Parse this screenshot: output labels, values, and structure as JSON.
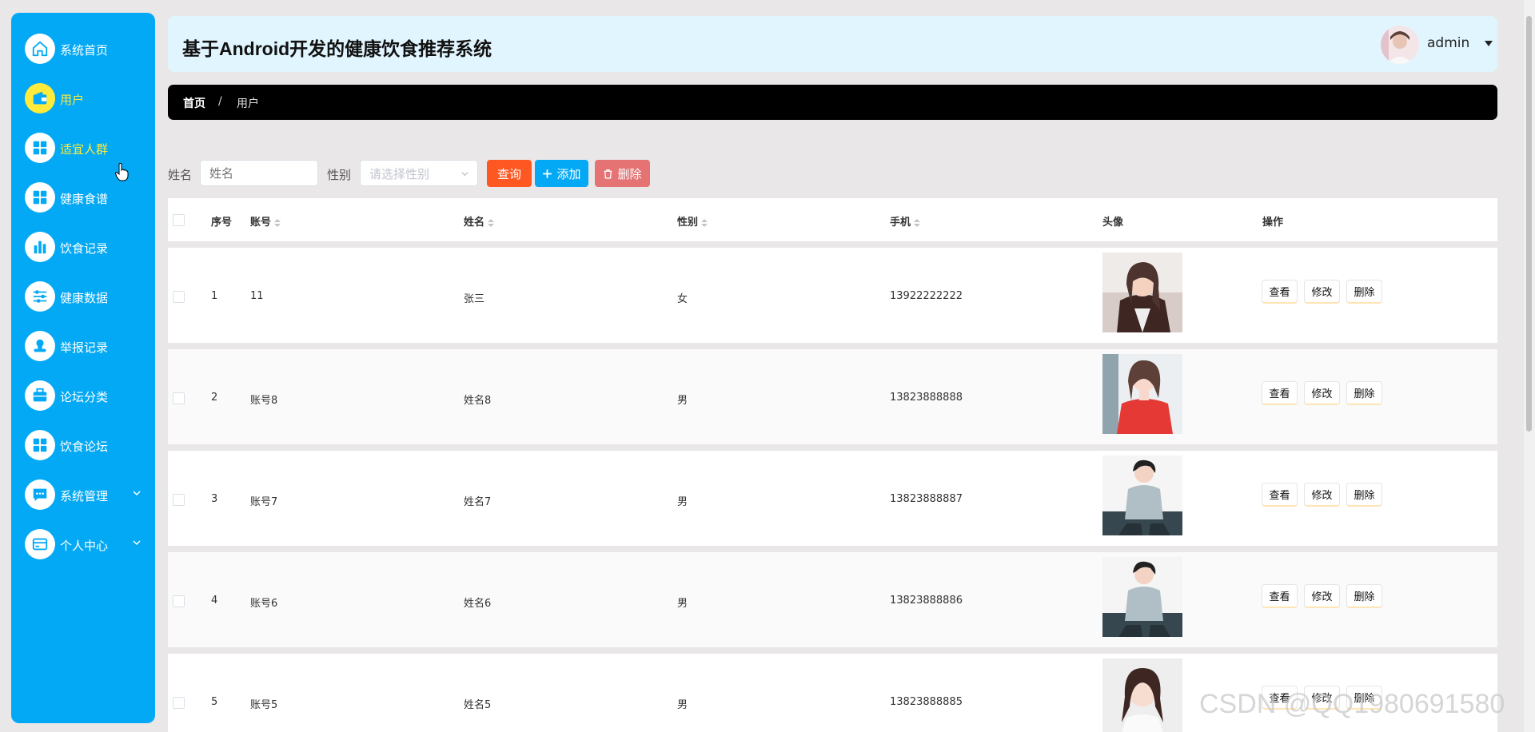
{
  "app": {
    "title": "基于Android开发的健康饮食推荐系统"
  },
  "user": {
    "name": "admin"
  },
  "sidebar": {
    "items": [
      {
        "label": "系统首页",
        "icon": "home-icon"
      },
      {
        "label": "用户",
        "icon": "wallet-icon"
      },
      {
        "label": "适宜人群",
        "icon": "grid-icon"
      },
      {
        "label": "健康食谱",
        "icon": "grid-icon"
      },
      {
        "label": "饮食记录",
        "icon": "bar-chart-icon"
      },
      {
        "label": "健康数据",
        "icon": "sliders-icon"
      },
      {
        "label": "举报记录",
        "icon": "stamp-icon"
      },
      {
        "label": "论坛分类",
        "icon": "briefcase-icon"
      },
      {
        "label": "饮食论坛",
        "icon": "grid-icon"
      },
      {
        "label": "系统管理",
        "icon": "chat-icon"
      },
      {
        "label": "个人中心",
        "icon": "card-icon"
      }
    ]
  },
  "breadcrumb": {
    "home": "首页",
    "separator": "/",
    "current": "用户"
  },
  "search": {
    "name_label": "姓名",
    "name_placeholder": "姓名",
    "gender_label": "性别",
    "gender_placeholder": "请选择性别",
    "query_button": "查询",
    "add_button": "添加",
    "delete_button": "删除"
  },
  "table": {
    "headers": {
      "index": "序号",
      "account": "账号",
      "name": "姓名",
      "gender": "性别",
      "phone": "手机",
      "avatar": "头像",
      "actions": "操作"
    },
    "action_labels": {
      "view": "查看",
      "edit": "修改",
      "delete": "删除"
    },
    "rows": [
      {
        "index": "1",
        "account": "11",
        "name": "张三",
        "gender": "女",
        "phone": "13922222222"
      },
      {
        "index": "2",
        "account": "账号8",
        "name": "姓名8",
        "gender": "男",
        "phone": "13823888888"
      },
      {
        "index": "3",
        "account": "账号7",
        "name": "姓名7",
        "gender": "男",
        "phone": "13823888887"
      },
      {
        "index": "4",
        "account": "账号6",
        "name": "姓名6",
        "gender": "男",
        "phone": "13823888886"
      },
      {
        "index": "5",
        "account": "账号5",
        "name": "姓名5",
        "gender": "男",
        "phone": "13823888885"
      }
    ]
  },
  "watermark": "CSDN @QQ1980691580",
  "colors": {
    "sidebar": "#03a9f4",
    "header": "#e1f5fe",
    "query": "#ff5722",
    "add": "#03a9f4",
    "delete": "#e57373",
    "highlight": "#ffeb3b"
  }
}
